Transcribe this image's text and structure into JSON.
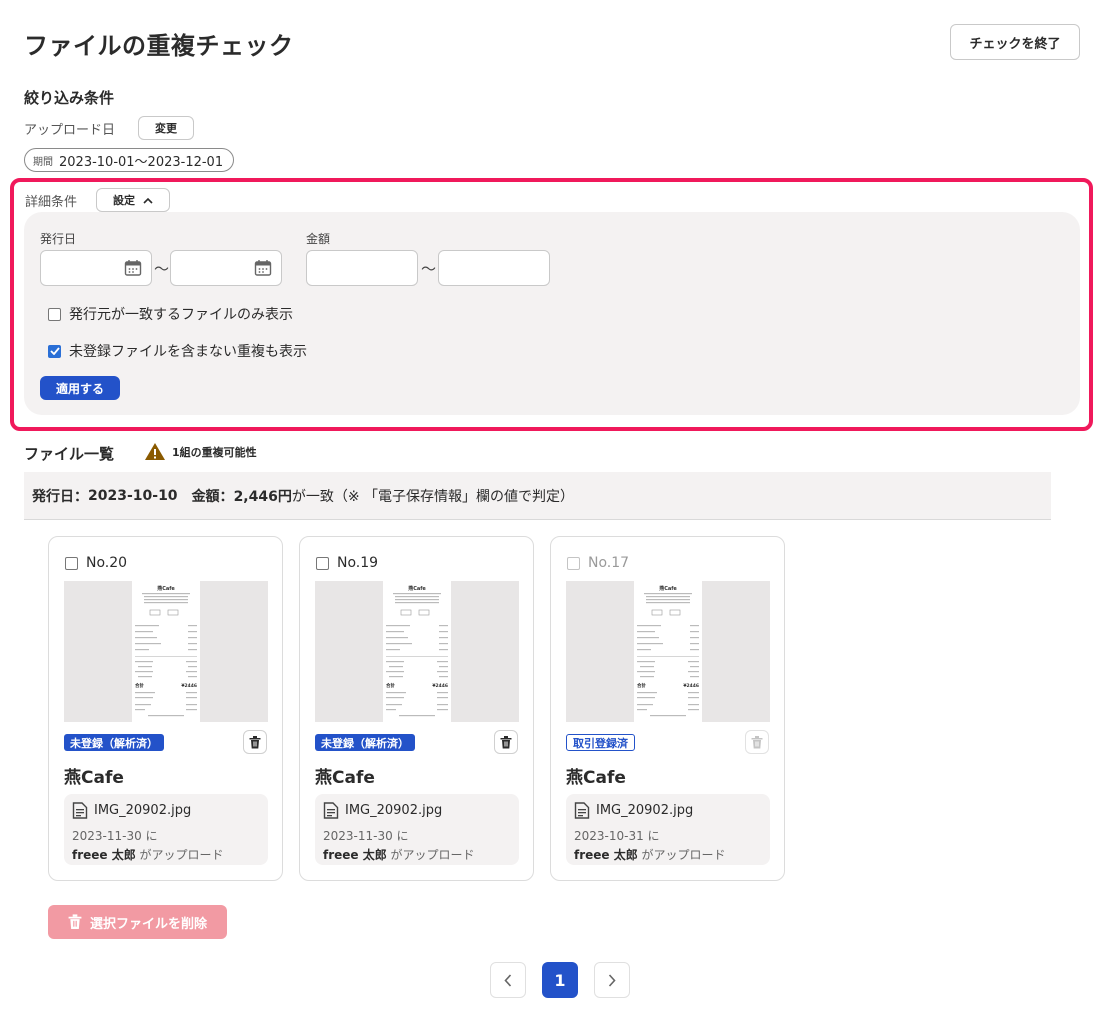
{
  "page": {
    "title": "ファイルの重複チェック",
    "end_button": "チェックを終了"
  },
  "filters": {
    "heading": "絞り込み条件",
    "upload_date_label": "アップロード日",
    "change_button": "変更",
    "period_tag": "期間",
    "period_value": "2023-10-01〜2023-12-01",
    "detail_label": "詳細条件",
    "settings_button": "設定",
    "issue_date_label": "発行日",
    "amount_label": "金額",
    "tilde": "〜",
    "issue_from": "",
    "issue_to": "",
    "amount_from": "",
    "amount_to": "",
    "check_same_issuer": {
      "label": "発行元が一致するファイルのみ表示",
      "checked": false
    },
    "check_unregistered": {
      "label": "未登録ファイルを含まない重複も表示",
      "checked": true
    },
    "apply_button": "適用する"
  },
  "file_list": {
    "title": "ファイル一覧",
    "warning": "1組の重複可能性",
    "match": {
      "issue_label": "発行日：",
      "issue_value": "2023-10-10",
      "amount_label": "金額：",
      "amount_value": "2,446円",
      "suffix": "が一致（※ 「電子保存情報」欄の値で判定）"
    },
    "cards": [
      {
        "number": "No.20",
        "badge": "未登録（解析済）",
        "badge_style": "solid",
        "issuer": "燕Cafe",
        "file_name": "IMG_20902.jpg",
        "date": "2023-11-30 に",
        "user": "freee 太郎",
        "user_suffix": " がアップロード",
        "disabled": false
      },
      {
        "number": "No.19",
        "badge": "未登録（解析済）",
        "badge_style": "solid",
        "issuer": "燕Cafe",
        "file_name": "IMG_20902.jpg",
        "date": "2023-11-30 に",
        "user": "freee 太郎",
        "user_suffix": " がアップロード",
        "disabled": false
      },
      {
        "number": "No.17",
        "badge": "取引登録済",
        "badge_style": "outline",
        "issuer": "燕Cafe",
        "file_name": "IMG_20902.jpg",
        "date": "2023-10-31 に",
        "user": "freee 太郎",
        "user_suffix": " がアップロード",
        "disabled": true
      }
    ],
    "receipt": {
      "store": "燕Cafe",
      "total_label": "合計",
      "total_value": "¥2446"
    }
  },
  "actions": {
    "delete_button": "選択ファイルを削除"
  },
  "pagination": {
    "current_page": "1"
  },
  "colors": {
    "accent": "#2352c9",
    "highlight_border": "#f0195b",
    "warning": "#8a5a00",
    "delete_disabled": "#f29aa3"
  }
}
